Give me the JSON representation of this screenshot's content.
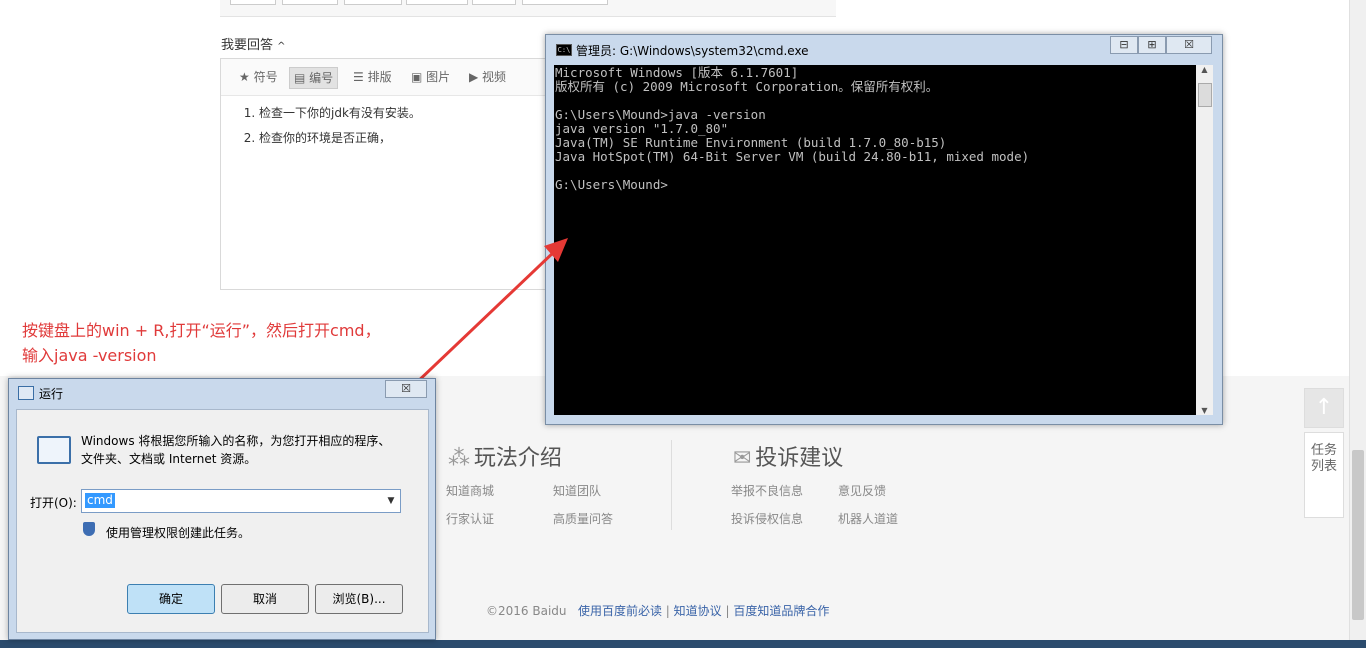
{
  "background_page": {
    "answer_title": "我要回答",
    "answer_caret": "^",
    "editor_tools": [
      "符号",
      "编号",
      "排版",
      "图片",
      "视频"
    ],
    "answer_items": [
      "检查一下你的jdk有没有安装。",
      "检查你的环境是否正确，"
    ],
    "footer": {
      "col1_title": "玩法介绍",
      "col1_links": [
        "知道商城",
        "知道团队",
        "行家认证",
        "高质量问答"
      ],
      "col2_title": "投诉建议",
      "col2_links": [
        "举报不良信息",
        "意见反馈",
        "投诉侵权信息",
        "机器人道道"
      ],
      "copyright": "©2016 Baidu",
      "links": [
        "使用百度前必读",
        "知道协议",
        "百度知道品牌合作"
      ],
      "sep": "|"
    },
    "side": {
      "up_icon": "↑",
      "task": "任务列表"
    }
  },
  "annotation": {
    "line1": "按键盘上的win + R,打开“运行”，然后打开cmd，",
    "line2": "输入java -version"
  },
  "cmd_window": {
    "title": "管理员: G:\\Windows\\system32\\cmd.exe",
    "icon_text": "C:\\",
    "buttons": {
      "minimize": "⊟",
      "maximize": "⊞",
      "close": "☒"
    },
    "output": "Microsoft Windows [版本 6.1.7601]\n版权所有 (c) 2009 Microsoft Corporation。保留所有权利。\n\nG:\\Users\\Mound>java -version\njava version \"1.7.0_80\"\nJava(TM) SE Runtime Environment (build 1.7.0_80-b15)\nJava HotSpot(TM) 64-Bit Server VM (build 24.80-b11, mixed mode)\n\nG:\\Users\\Mound>"
  },
  "run_dialog": {
    "title": "运行",
    "close": "☒",
    "description": "Windows 将根据您所输入的名称，为您打开相应的程序、文件夹、文档或 Internet 资源。",
    "open_label": "打开(O):",
    "open_value": "cmd",
    "admin_note": "使用管理权限创建此任务。",
    "ok": "确定",
    "cancel": "取消",
    "browse": "浏览(B)..."
  }
}
